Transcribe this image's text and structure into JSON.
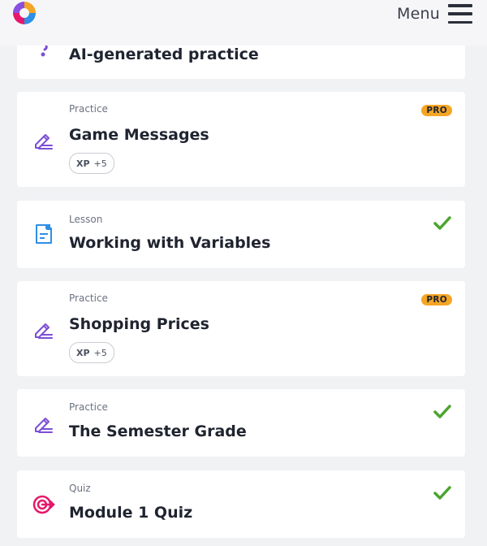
{
  "header": {
    "menu_label": "Menu"
  },
  "cards": [
    {
      "type": "",
      "title": "AI-generated practice",
      "icon": "ai-practice-icon"
    },
    {
      "type": "Practice",
      "title": "Game Messages",
      "badge": "PRO",
      "xp_label": "XP",
      "xp_value": "+5",
      "icon": "pencil-icon"
    },
    {
      "type": "Lesson",
      "title": "Working with Variables",
      "completed": true,
      "icon": "lesson-document-icon"
    },
    {
      "type": "Practice",
      "title": "Shopping Prices",
      "badge": "PRO",
      "xp_label": "XP",
      "xp_value": "+5",
      "icon": "pencil-icon"
    },
    {
      "type": "Practice",
      "title": "The Semester Grade",
      "completed": true,
      "icon": "pencil-icon"
    },
    {
      "type": "Quiz",
      "title": "Module 1 Quiz",
      "completed": true,
      "icon": "quiz-target-icon"
    }
  ],
  "colors": {
    "practice_icon": "#7b4fd6",
    "lesson_icon": "#2f8fe6",
    "quiz_icon": "#e6186b",
    "check": "#4aa52e",
    "pro_badge": "#f5a524"
  }
}
